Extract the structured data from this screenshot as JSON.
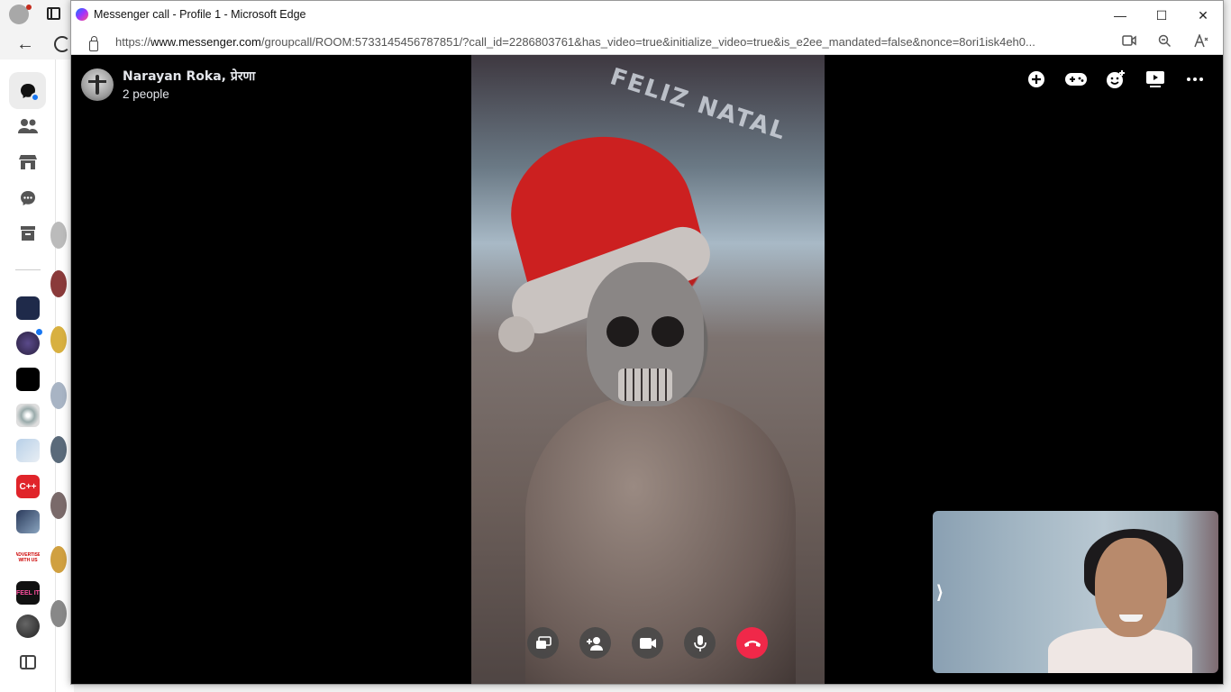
{
  "window": {
    "title": "Messenger call - Profile 1 - Microsoft Edge",
    "url_prefix": "https://",
    "url_host": "www.messenger.com",
    "url_path": "/groupcall/ROOM:5733145456787851/?call_id=2286803761&has_video=true&initialize_video=true&is_e2ee_mandated=false&nonce=8ori1isk4eh0...",
    "minimize": "—",
    "maximize": "☐",
    "close": "✕"
  },
  "call": {
    "caller_name": "Narayan Roka, प्रेरणा",
    "participants": "2 people",
    "video_overlay_text": "FELIZ NATAL",
    "collapse_glyph": "⟩"
  },
  "sidebar_thumbs": [
    "",
    "",
    "",
    "",
    "",
    "C++",
    "",
    "ADVERTISE WITH US",
    "FEEL IT",
    ""
  ],
  "colors": {
    "end_call": "#f02849",
    "accent": "#1877f2"
  },
  "icons": {
    "top_actions": [
      "plus-circle-icon",
      "gamepad-icon",
      "add-emoji-icon",
      "video-play-icon",
      "more-icon"
    ],
    "controls": [
      "share-screen-icon",
      "add-person-icon",
      "video-camera-icon",
      "microphone-icon",
      "end-call-icon"
    ]
  }
}
